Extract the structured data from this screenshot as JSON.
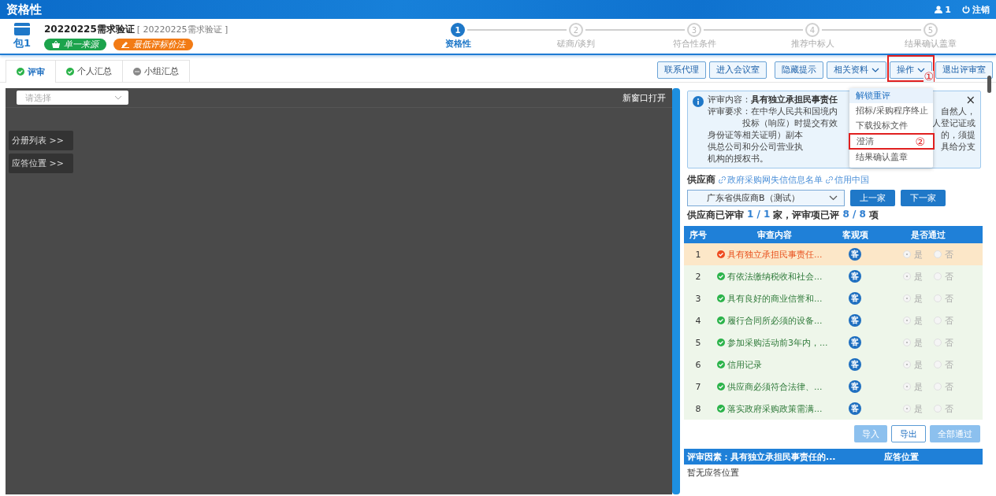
{
  "header": {
    "title": "资格性",
    "user_count": "1",
    "logout": "注销"
  },
  "package": {
    "label": "包1",
    "title": "20220225需求验证",
    "subtitle": "[ 20220225需求验证 ]",
    "tags": [
      {
        "text": "单一来源",
        "color": "#1ca34c",
        "kind": "basket"
      },
      {
        "text": "最低评标价法",
        "color": "#f27b15",
        "kind": "pen"
      }
    ]
  },
  "steps": [
    {
      "number": "1",
      "label": "资格性",
      "selected": true
    },
    {
      "number": "2",
      "label": "磋商/谈判",
      "selected": false
    },
    {
      "number": "3",
      "label": "符合性条件",
      "selected": false
    },
    {
      "number": "4",
      "label": "推荐中标人",
      "selected": false
    },
    {
      "number": "5",
      "label": "结果确认盖章",
      "selected": false
    }
  ],
  "tabs": [
    {
      "label": "评审",
      "selected": true,
      "complete": true
    },
    {
      "label": "个人汇总",
      "selected": false,
      "complete": true
    },
    {
      "label": "小组汇总",
      "selected": false,
      "complete": false
    }
  ],
  "toolbar": {
    "groups": [
      {
        "buttons": [
          {
            "label": "联系代理",
            "dropdown": false
          },
          {
            "label": "进入会议室",
            "dropdown": false
          }
        ]
      },
      {
        "buttons": [
          {
            "label": "隐藏提示",
            "dropdown": false
          },
          {
            "label": "相关资料",
            "dropdown": true
          },
          {
            "label": "操作",
            "dropdown": true,
            "annotation": "①"
          },
          {
            "label": "退出评审室",
            "dropdown": false
          }
        ]
      }
    ]
  },
  "menu": {
    "items": [
      {
        "label": "解锁重评",
        "highlighted": true
      },
      {
        "label": "招标/采购程序终止",
        "highlighted": false
      },
      {
        "label": "下载投标文件",
        "highlighted": false
      },
      {
        "label": "澄清",
        "highlighted": false,
        "annotation": "②"
      },
      {
        "label": "结果确认盖章",
        "highlighted": false
      }
    ]
  },
  "viewer": {
    "select_placeholder": "请选择",
    "open_new": "新窗口打开",
    "side_buttons": [
      "分册列表 >>",
      "应答位置 >>"
    ]
  },
  "info": {
    "title_label": "评审内容：",
    "title": "具有独立承担民事责任",
    "close": "×",
    "lines": [
      {
        "left": "评审要求：在中华人民共和国境内",
        "right": "自然人，",
        "indent": false
      },
      {
        "left": "投标（响应）时提交有效",
        "right": "人登记证或",
        "indent": true
      },
      {
        "left": "身份证等相关证明）副本",
        "right": "的，须提",
        "indent": false
      },
      {
        "left": "供总公司和分公司营业执",
        "right": "具给分支",
        "indent": false
      },
      {
        "left": "机构的授权书。",
        "indent": false
      }
    ]
  },
  "supplier": {
    "label": "供应商",
    "links": [
      "政府采购网失信信息名单",
      "信用中国"
    ],
    "selected": "广东省供应商B（测试）",
    "prev": "上一家",
    "next": "下一家",
    "progress": {
      "reviewed_label": "供应商已评审",
      "reviewed": "1 / 1",
      "items_label": "家，评审项已评",
      "items": "8 / 8",
      "unit": "项"
    }
  },
  "table": {
    "columns": [
      "序号",
      "审查内容",
      "客观项",
      "是否通过"
    ],
    "rows": [
      {
        "index": "1",
        "content": "具有独立承担民事责任...",
        "error": true,
        "selected": true,
        "badge": "客",
        "yes": "是",
        "no": "否",
        "passed": true
      },
      {
        "index": "2",
        "content": "有依法缴纳税收和社会...",
        "error": false,
        "selected": false,
        "badge": "客",
        "yes": "是",
        "no": "否",
        "passed": true
      },
      {
        "index": "3",
        "content": "具有良好的商业信誉和...",
        "error": false,
        "selected": false,
        "badge": "客",
        "yes": "是",
        "no": "否",
        "passed": true
      },
      {
        "index": "4",
        "content": "履行合同所必须的设备...",
        "error": false,
        "selected": false,
        "badge": "客",
        "yes": "是",
        "no": "否",
        "passed": true
      },
      {
        "index": "5",
        "content": "参加采购活动前3年内，...",
        "error": false,
        "selected": false,
        "badge": "客",
        "yes": "是",
        "no": "否",
        "passed": true
      },
      {
        "index": "6",
        "content": "信用记录",
        "error": false,
        "selected": false,
        "badge": "客",
        "yes": "是",
        "no": "否",
        "passed": true
      },
      {
        "index": "7",
        "content": "供应商必须符合法律、...",
        "error": false,
        "selected": false,
        "badge": "客",
        "yes": "是",
        "no": "否",
        "passed": true
      },
      {
        "index": "8",
        "content": "落实政府采购政策需满...",
        "error": false,
        "selected": false,
        "badge": "客",
        "yes": "是",
        "no": "否",
        "passed": true
      }
    ]
  },
  "actions": [
    {
      "label": "导入",
      "kind": "faded"
    },
    {
      "label": "导出",
      "kind": "outline"
    },
    {
      "label": "全部通过",
      "kind": "faded"
    }
  ],
  "answer_table": {
    "columns": [
      "评审因素：具有独立承担民事责任的...",
      "应答位置"
    ],
    "empty": "暂无应答位置"
  }
}
